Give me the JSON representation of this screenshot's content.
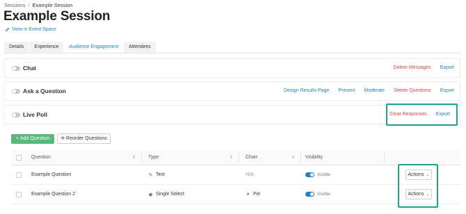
{
  "breadcrumb": {
    "root": "Sessions",
    "separator": "/",
    "current": "Example Session"
  },
  "page": {
    "title": "Example Session",
    "event_space_link": "View in Event Space"
  },
  "tabs": [
    {
      "label": "Details",
      "active": false
    },
    {
      "label": "Experience",
      "active": false
    },
    {
      "label": "Audience Engagement",
      "active": true
    },
    {
      "label": "Attendees",
      "active": false
    }
  ],
  "sections": {
    "chat": {
      "title": "Chat",
      "enabled": false,
      "actions": [
        "Delete Messages",
        "Export"
      ]
    },
    "ask_question": {
      "title": "Ask a Question",
      "enabled": false,
      "actions": [
        "Design Results Page",
        "Present",
        "Moderate",
        "Delete Questions",
        "Export"
      ]
    },
    "live_poll": {
      "title": "Live Poll",
      "enabled": false,
      "actions": [
        "Clear Responses",
        "Export"
      ]
    }
  },
  "poll_toolbar": {
    "add_label": "Add Question",
    "reorder_label": "Reorder Questions"
  },
  "table": {
    "columns": [
      "Question",
      "Type",
      "Chart",
      "Visibility"
    ],
    "rows": [
      {
        "question": "Example Question",
        "type": "Text",
        "type_icon": "pencil-icon",
        "chart": "N/A",
        "chart_icon": "",
        "visibility": "Visible",
        "visible": true,
        "action_label": "Actions"
      },
      {
        "question": "Example Question 2",
        "type": "Single Select",
        "type_icon": "radio-icon",
        "chart": "Pie",
        "chart_icon": "pie-chart-icon",
        "visibility": "Visible",
        "visible": true,
        "action_label": "Actions"
      }
    ]
  },
  "colors": {
    "accent": "#1f7fd1",
    "danger": "#e04848",
    "success": "#5cb87a",
    "highlight": "#1aa394"
  }
}
